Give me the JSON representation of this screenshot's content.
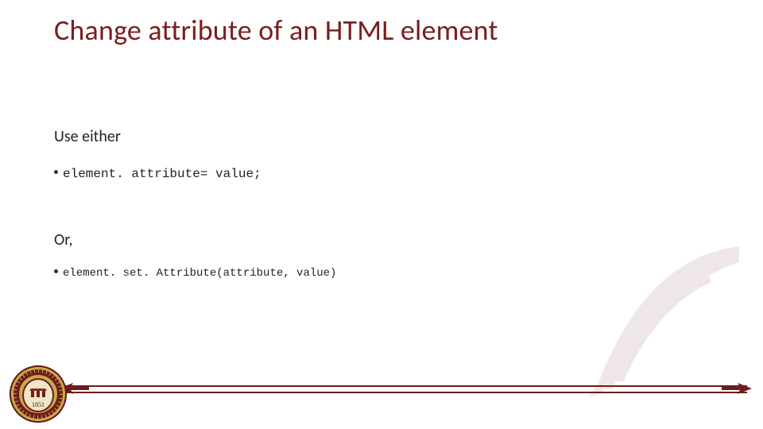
{
  "title": "Change attribute of an HTML element",
  "intro": "Use either",
  "code1": "element. attribute= value;",
  "or": "Or,",
  "code2": "element. set. Attribute(attribute, value)",
  "seal_year": "1851",
  "colors": {
    "accent": "#7a1e1e",
    "rule": "#6e1d1d",
    "gold": "#c9a94a"
  }
}
